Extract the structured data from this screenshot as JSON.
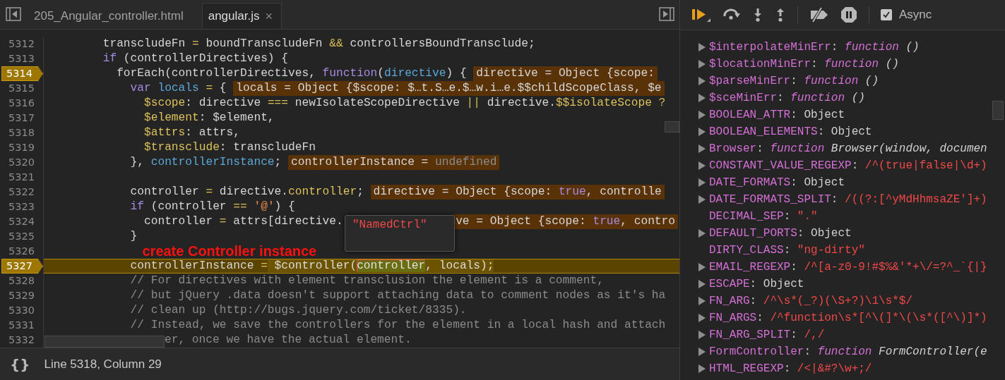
{
  "tabs": [
    {
      "label": "205_Angular_controller.html",
      "selected": false,
      "closable": false
    },
    {
      "label": "angular.js",
      "selected": true,
      "closable": true,
      "close": "×"
    }
  ],
  "editor": {
    "lines": [
      {
        "n": "5312",
        "breakpoint": false,
        "current": false,
        "covered": false,
        "kind": "code",
        "code": [
          {
            "t": "        transcludeFn ",
            "kind": "plain"
          },
          {
            "t": "=",
            "kind": "op"
          },
          {
            "t": " boundTranscludeFn ",
            "kind": "plain"
          },
          {
            "t": "&&",
            "kind": "op"
          },
          {
            "t": " controllersBoundTransclude;",
            "kind": "plain"
          }
        ]
      },
      {
        "n": "5313",
        "breakpoint": false,
        "current": false,
        "covered": false,
        "kind": "code",
        "code": [
          {
            "t": "        if",
            "kind": "kw"
          },
          {
            "t": " (controllerDirectives) {",
            "kind": "plain"
          }
        ]
      },
      {
        "n": "5314",
        "breakpoint": true,
        "current": false,
        "covered": false,
        "kind": "code",
        "code": [
          {
            "t": "          forEach(controllerDirectives, ",
            "kind": "plain"
          },
          {
            "t": "function",
            "kind": "kw"
          },
          {
            "t": "(",
            "kind": "plain"
          },
          {
            "t": "directive",
            "kind": "param"
          },
          {
            "t": ") {",
            "kind": "plain"
          }
        ],
        "inline": {
          "covered": false,
          "parts": [
            {
              "t": "directive = Object {scope:",
              "kind": "plain"
            }
          ]
        }
      },
      {
        "n": "5315",
        "breakpoint": false,
        "current": false,
        "covered": false,
        "kind": "code",
        "code": [
          {
            "t": "            var",
            "kind": "kw"
          },
          {
            "t": " locals",
            "kind": "param"
          },
          {
            "t": " =",
            "kind": "op"
          },
          {
            "t": " {",
            "kind": "plain"
          }
        ],
        "inline": {
          "covered": false,
          "parts": [
            {
              "t": "locals = Object {$scope: $…t.S…e.$…w.i…e.$$childScopeClass, $e",
              "kind": "plain"
            }
          ]
        }
      },
      {
        "n": "5316",
        "breakpoint": false,
        "current": false,
        "covered": false,
        "kind": "code",
        "code": [
          {
            "t": "              $scope",
            "kind": "prop"
          },
          {
            "t": ": directive ",
            "kind": "plain"
          },
          {
            "t": "===",
            "kind": "op"
          },
          {
            "t": " newIsolateScopeDirective ",
            "kind": "plain"
          },
          {
            "t": "||",
            "kind": "op"
          },
          {
            "t": " directive.",
            "kind": "plain"
          },
          {
            "t": "$$isolateScope",
            "kind": "prop"
          },
          {
            "t": " ?",
            "kind": "op"
          }
        ]
      },
      {
        "n": "5317",
        "breakpoint": false,
        "current": false,
        "covered": false,
        "kind": "code",
        "code": [
          {
            "t": "              $element",
            "kind": "prop"
          },
          {
            "t": ": $element,",
            "kind": "plain"
          }
        ]
      },
      {
        "n": "5318",
        "breakpoint": false,
        "current": false,
        "covered": false,
        "kind": "code",
        "code": [
          {
            "t": "              $attrs",
            "kind": "prop"
          },
          {
            "t": ": attrs,",
            "kind": "plain"
          }
        ]
      },
      {
        "n": "5319",
        "breakpoint": false,
        "current": false,
        "covered": false,
        "kind": "code",
        "code": [
          {
            "t": "              $transclude",
            "kind": "prop"
          },
          {
            "t": ": transcludeFn",
            "kind": "plain"
          }
        ]
      },
      {
        "n": "5320",
        "breakpoint": false,
        "current": false,
        "covered": false,
        "kind": "code",
        "code": [
          {
            "t": "            },",
            "kind": "plain"
          },
          {
            "t": " controllerInstance",
            "kind": "param"
          },
          {
            "t": ";",
            "kind": "plain"
          }
        ],
        "inline": {
          "covered": false,
          "parts": [
            {
              "t": "controllerInstance = ",
              "kind": "plain"
            },
            {
              "t": "undefined",
              "kind": "muted"
            }
          ]
        }
      },
      {
        "n": "5321",
        "breakpoint": false,
        "current": false,
        "kind": "code"
      },
      {
        "n": "5322",
        "breakpoint": false,
        "current": false,
        "covered": false,
        "kind": "code",
        "code": [
          {
            "t": "            controller ",
            "kind": "plain"
          },
          {
            "t": "=",
            "kind": "op"
          },
          {
            "t": " directive.",
            "kind": "plain"
          },
          {
            "t": "controller",
            "kind": "prop"
          },
          {
            "t": ";",
            "kind": "plain"
          }
        ],
        "inline": {
          "covered": false,
          "parts": [
            {
              "t": "directive = Object {scope: ",
              "kind": "plain"
            },
            {
              "t": "true",
              "kind": "kw"
            },
            {
              "t": ", controlle",
              "kind": "plain"
            }
          ]
        }
      },
      {
        "n": "5323",
        "breakpoint": false,
        "current": false,
        "covered": false,
        "kind": "code",
        "code": [
          {
            "t": "            if",
            "kind": "kw"
          },
          {
            "t": " (controller ",
            "kind": "plain"
          },
          {
            "t": "==",
            "kind": "op"
          },
          {
            "t": " '@'",
            "kind": "str"
          },
          {
            "t": ") {",
            "kind": "plain"
          }
        ]
      },
      {
        "n": "5324",
        "breakpoint": false,
        "current": false,
        "covered": false,
        "kind": "code",
        "code": [
          {
            "t": "              controller ",
            "kind": "plain"
          },
          {
            "t": "=",
            "kind": "op"
          },
          {
            "t": " attrs[directive.",
            "kind": "plain"
          }
        ],
        "inline": {
          "covered": true,
          "parts": [
            {
              "t": "ve = Object {scope: ",
              "kind": "plain"
            },
            {
              "t": "true",
              "kind": "kw"
            },
            {
              "t": ", contro",
              "kind": "plain"
            }
          ]
        }
      },
      {
        "n": "5325",
        "breakpoint": false,
        "current": false,
        "covered": false,
        "kind": "code",
        "code": [
          {
            "t": "            }",
            "kind": "plain"
          }
        ]
      },
      {
        "n": "5326",
        "breakpoint": false,
        "current": false,
        "covered": false,
        "kind": "note",
        "code": [
          {
            "t": "create Controller instance",
            "kind": "note"
          }
        ]
      },
      {
        "n": "5327",
        "breakpoint": true,
        "current": true,
        "covered": false,
        "kind": "code",
        "code": [
          {
            "t": "            controllerInstance ",
            "kind": "plain"
          },
          {
            "t": "=",
            "kind": "op"
          },
          {
            "t": " $controller(",
            "kind": "eval"
          },
          {
            "t": "controller",
            "kind": "hover"
          },
          {
            "t": ", locals);",
            "kind": "eval"
          }
        ]
      },
      {
        "n": "5328",
        "breakpoint": false,
        "current": false,
        "covered": false,
        "kind": "code",
        "code": [
          {
            "t": "            // For directives with element transclusion the element is a comment,",
            "kind": "cmt"
          }
        ]
      },
      {
        "n": "5329",
        "breakpoint": false,
        "current": false,
        "covered": false,
        "kind": "code",
        "code": [
          {
            "t": "            // but jQuery .data doesn't support attaching data to comment nodes as it's ha",
            "kind": "cmt"
          }
        ]
      },
      {
        "n": "5330",
        "breakpoint": false,
        "current": false,
        "covered": false,
        "kind": "code",
        "code": [
          {
            "t": "            // clean up (http://bugs.jquery.com/ticket/8335).",
            "kind": "cmt"
          }
        ]
      },
      {
        "n": "5331",
        "breakpoint": false,
        "current": false,
        "covered": false,
        "kind": "code",
        "code": [
          {
            "t": "            // Instead, we save the controllers for the element in a local hash and attach",
            "kind": "cmt"
          }
        ]
      },
      {
        "n": "5332",
        "breakpoint": false,
        "current": false,
        "covered": true,
        "kind": "code",
        "code": [
          {
            "t": "er, once we have the actual element.",
            "kind": "cmt"
          }
        ]
      }
    ],
    "tooltip": {
      "text": "\"NamedCtrl\""
    }
  },
  "status_bar": {
    "format": "{}",
    "position": "Line 5318, Column 29"
  },
  "debugger": {
    "async": {
      "label": "Async",
      "checked": true
    },
    "scope": [
      {
        "key": "$interpolateMinErr:",
        "expandable": true,
        "kind": "function",
        "keyword": "function",
        "value": "()"
      },
      {
        "key": "$locationMinErr:",
        "expandable": true,
        "kind": "function",
        "keyword": "function",
        "value": "()"
      },
      {
        "key": "$parseMinErr:",
        "expandable": true,
        "kind": "function",
        "keyword": "function",
        "value": "()"
      },
      {
        "key": "$sceMinErr:",
        "expandable": true,
        "kind": "function",
        "keyword": "function",
        "value": "()"
      },
      {
        "key": "BOOLEAN_ATTR:",
        "expandable": true,
        "kind": "object",
        "value": "Object"
      },
      {
        "key": "BOOLEAN_ELEMENTS:",
        "expandable": true,
        "kind": "object",
        "value": "Object"
      },
      {
        "key": "Browser:",
        "expandable": true,
        "kind": "function",
        "keyword": "function",
        "value": "Browser(window, documen"
      },
      {
        "key": "CONSTANT_VALUE_REGEXP:",
        "expandable": true,
        "kind": "regexp",
        "value": "/^(true|false|\\d+)"
      },
      {
        "key": "DATE_FORMATS:",
        "expandable": true,
        "kind": "object",
        "value": "Object"
      },
      {
        "key": "DATE_FORMATS_SPLIT:",
        "expandable": true,
        "kind": "regexp",
        "value": "/((?:[^yMdHhmsaZE']+)"
      },
      {
        "key": "DECIMAL_SEP:",
        "expandable": false,
        "kind": "string",
        "value": "\".\""
      },
      {
        "key": "DEFAULT_PORTS:",
        "expandable": true,
        "kind": "object",
        "value": "Object"
      },
      {
        "key": "DIRTY_CLASS:",
        "expandable": false,
        "kind": "string",
        "value": "\"ng-dirty\""
      },
      {
        "key": "EMAIL_REGEXP:",
        "expandable": true,
        "kind": "regexp",
        "value": "/^[a-z0-9!#$%&'*+\\/=?^_`{|}"
      },
      {
        "key": "ESCAPE:",
        "expandable": true,
        "kind": "object",
        "value": "Object"
      },
      {
        "key": "FN_ARG:",
        "expandable": true,
        "kind": "regexp",
        "value": "/^\\s*(_?)(\\S+?)\\1\\s*$/"
      },
      {
        "key": "FN_ARGS:",
        "expandable": true,
        "kind": "regexp",
        "value": "/^function\\s*[^\\(]*\\(\\s*([^\\)]*)"
      },
      {
        "key": "FN_ARG_SPLIT:",
        "expandable": true,
        "kind": "regexp",
        "value": "/,/"
      },
      {
        "key": "FormController:",
        "expandable": true,
        "kind": "function",
        "keyword": "function",
        "value": "FormController(e"
      },
      {
        "key": "HTML_REGEXP:",
        "expandable": true,
        "kind": "regexp",
        "value": "/<|&#?\\w+;/"
      }
    ]
  }
}
